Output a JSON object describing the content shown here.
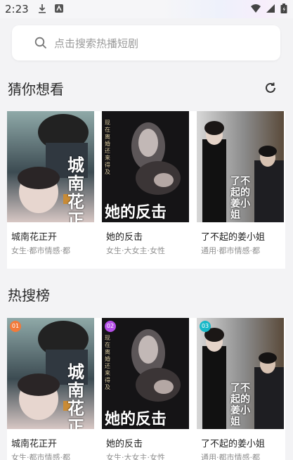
{
  "status_bar": {
    "time": "2:23"
  },
  "search": {
    "placeholder": "点击搜索热播短剧"
  },
  "guess": {
    "title": "猜你想看",
    "items": [
      {
        "title": "城南花正开",
        "tags": "女生·都市情感·都",
        "cover_text": "城南花正开"
      },
      {
        "title": "她的反击",
        "tags": "女生·大女主·女性",
        "cover_text": "她的反击",
        "cover_side": "现在离婚还来得及"
      },
      {
        "title": "了不起的姜小姐",
        "tags": "通用·都市情感·都",
        "cover_text": "了不起的姜小姐"
      }
    ]
  },
  "hot": {
    "title": "热搜榜",
    "items": [
      {
        "rank": "01",
        "rank_color": "#f27a3a",
        "title": "城南花正开",
        "tags": "女生·都市情感·都",
        "cover_text": "城南花正开"
      },
      {
        "rank": "02",
        "rank_color": "#b54fe8",
        "title": "她的反击",
        "tags": "女生·大女主·女性",
        "cover_text": "她的反击",
        "cover_side": "现在离婚还来得及"
      },
      {
        "rank": "03",
        "rank_color": "#19b8c8",
        "title": "了不起的姜小姐",
        "tags": "通用·都市情感·都",
        "cover_text": "了不起的姜小姐"
      }
    ]
  }
}
